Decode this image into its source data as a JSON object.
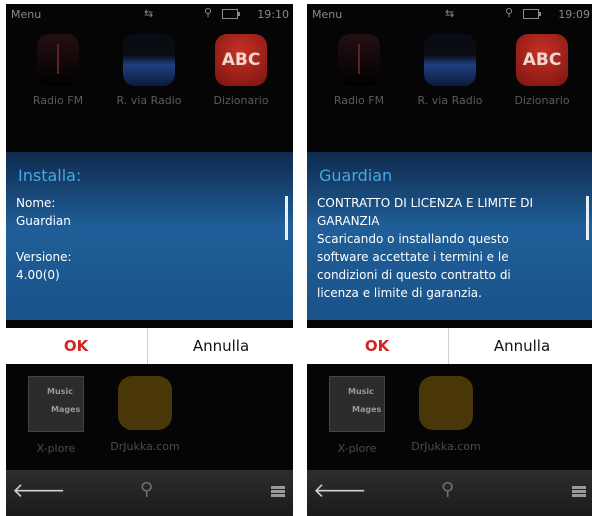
{
  "screens": [
    {
      "statusbar": {
        "menu": "Menu",
        "time": "19:10"
      },
      "apps_top": [
        {
          "label": "Radio FM",
          "icon": "radio-icon"
        },
        {
          "label": "R. via Radio",
          "icon": "wireless-radio-icon"
        },
        {
          "label": "Dizionario",
          "icon_text": "ABC"
        }
      ],
      "dialog": {
        "title": "Installa:",
        "lines": [
          "Nome:",
          "Guardian",
          "",
          "Versione:",
          "4.00(0)"
        ]
      },
      "buttons": {
        "ok": "OK",
        "cancel": "Annulla"
      },
      "apps_bottom": [
        {
          "label": "X-plore",
          "icon_text_1": "Music",
          "icon_text_2": "Mages"
        },
        {
          "label": "DrJukka.com"
        }
      ]
    },
    {
      "statusbar": {
        "menu": "Menu",
        "time": "19:09"
      },
      "apps_top": [
        {
          "label": "Radio FM",
          "icon": "radio-icon"
        },
        {
          "label": "R. via Radio",
          "icon": "wireless-radio-icon"
        },
        {
          "label": "Dizionario",
          "icon_text": "ABC"
        }
      ],
      "dialog": {
        "title": "Guardian",
        "lines": [
          "CONTRATTO DI LICENZA E LIMITE DI",
          "GARANZIA",
          "Scaricando o installando questo",
          "software accettate i termini e le",
          "condizioni di questo contratto di",
          "licenza e limite di garanzia."
        ]
      },
      "buttons": {
        "ok": "OK",
        "cancel": "Annulla"
      },
      "apps_bottom": [
        {
          "label": "X-plore",
          "icon_text_1": "Music",
          "icon_text_2": "Mages"
        },
        {
          "label": "DrJukka.com"
        }
      ]
    }
  ],
  "colors": {
    "dialog_title": "#46a8e4",
    "ok_button": "#d22424",
    "dialog_background": "#1f5f99"
  }
}
